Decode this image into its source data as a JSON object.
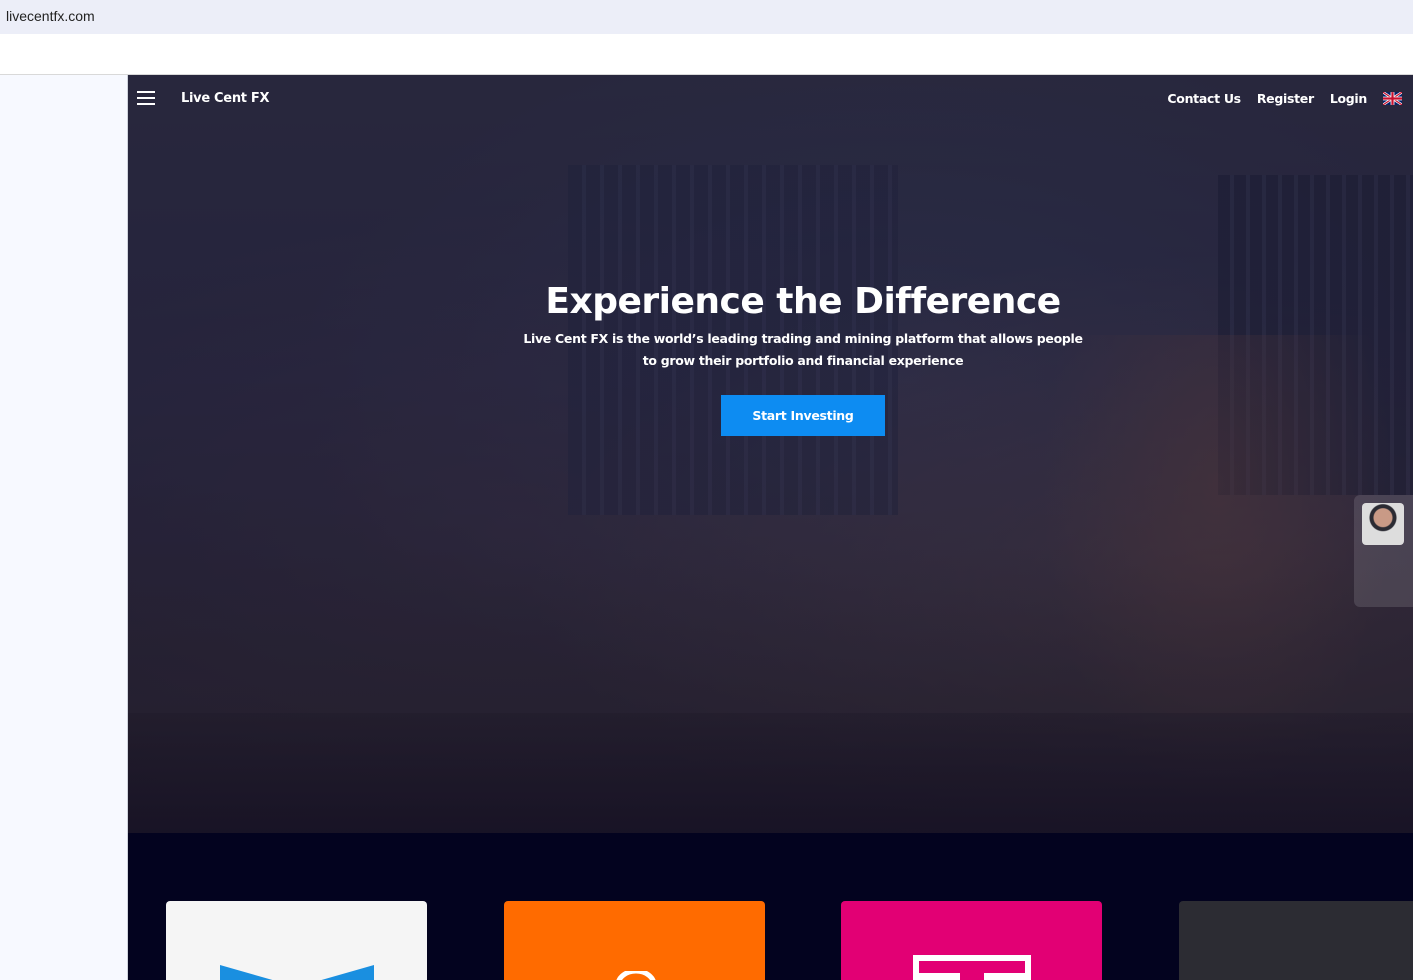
{
  "browser": {
    "url": "livecentfx.com"
  },
  "nav": {
    "brand": "Live Cent FX",
    "links": [
      "Contact Us",
      "Register",
      "Login"
    ],
    "language_icon": "uk-flag-icon",
    "menu_icon": "hamburger-icon"
  },
  "hero": {
    "title": "Experience the Difference",
    "subtitle": "Live Cent FX is the world’s leading trading and mining platform that allows people to grow their portfolio and financial experience",
    "cta_label": "Start Investing"
  },
  "colors": {
    "cta": "#0d8cf2",
    "background": "#03031f",
    "card_orange": "#ff6b00",
    "card_magenta": "#e20074",
    "card_dark": "#2c2c33",
    "card_light": "#f5f5f5"
  },
  "partner_cards": [
    {
      "logo": "blue-m-logo-icon"
    },
    {
      "logo": "orange-logo-icon"
    },
    {
      "logo": "telekom-logo-icon"
    },
    {
      "logo": "dark-logo-icon"
    }
  ]
}
